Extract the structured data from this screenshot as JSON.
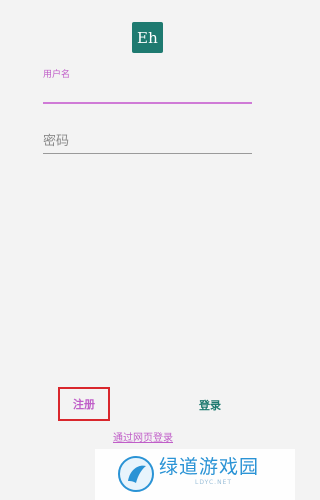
{
  "app": {
    "icon_text": "Eh",
    "icon_color": "#1e7a70"
  },
  "form": {
    "username_label": "用户名",
    "username_value": "",
    "password_placeholder": "密码",
    "password_value": ""
  },
  "actions": {
    "register_label": "注册",
    "login_label": "登录",
    "web_login_label": "通过网页登录"
  },
  "colors": {
    "accent": "#c05ec8",
    "primary": "#1e7a70",
    "highlight_box": "#d9262c",
    "background": "#f3f3f3"
  },
  "watermark": {
    "title": "绿道游戏园",
    "subtitle": "LDYC.NET"
  }
}
